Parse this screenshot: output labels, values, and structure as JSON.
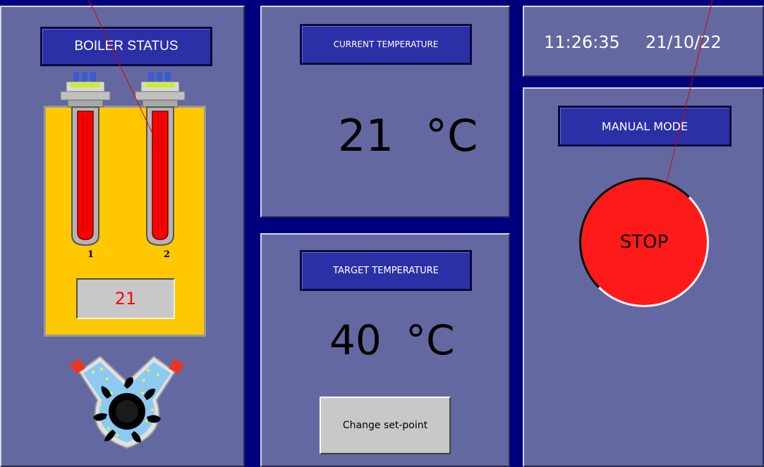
{
  "boiler": {
    "title": "BOILER STATUS",
    "heater1_label": "1",
    "heater2_label": "2",
    "level_value": "21"
  },
  "current": {
    "title": "CURRENT TEMPERATURE",
    "value": "21",
    "unit": "°C"
  },
  "target": {
    "title": "TARGET TEMPERATURE",
    "value": "40",
    "unit": "°C",
    "change_button": "Change set-point"
  },
  "clock": {
    "time": "11:26:35",
    "date": "21/10/22"
  },
  "mode": {
    "title": "MANUAL MODE",
    "stop_button": "STOP"
  },
  "colors": {
    "background": "#00007e",
    "panel": "#6468a0",
    "label_box": "#2c30a6",
    "tank": "#ffc800",
    "heater": "#ff0000",
    "stop": "#ff1a1a",
    "level_text": "#ff0000"
  },
  "icons": [
    "immersion-heater-icon",
    "pump-icon"
  ]
}
